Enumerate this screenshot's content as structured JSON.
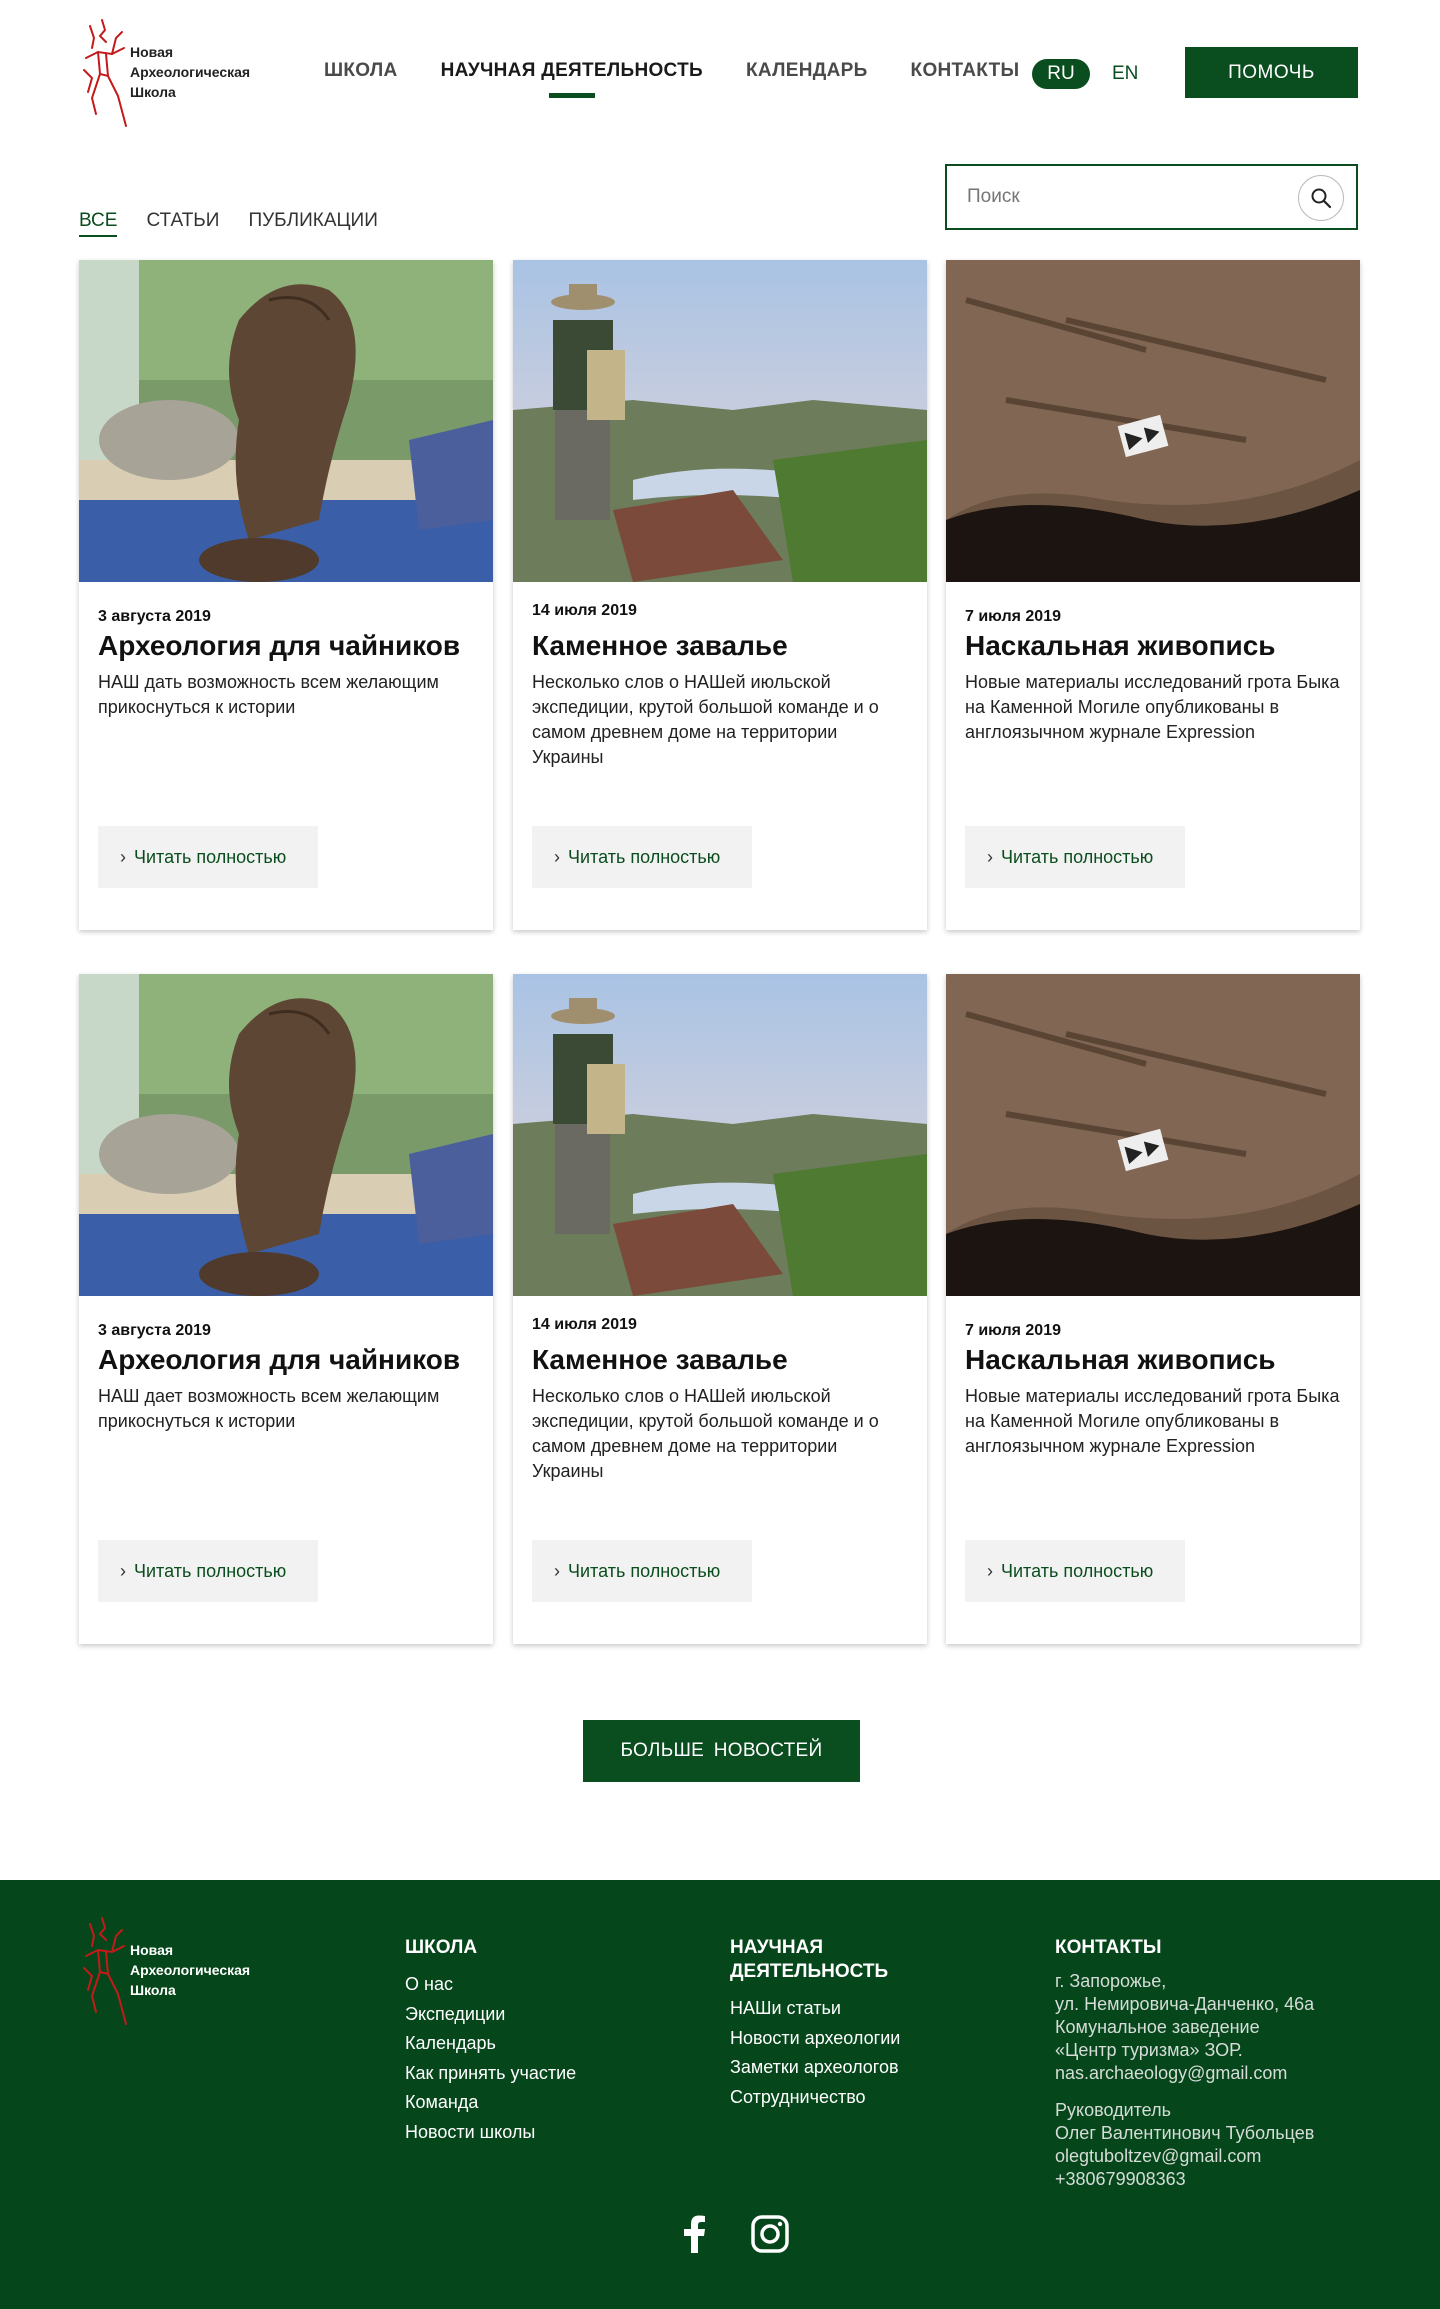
{
  "header": {
    "logo_lines": [
      "Новая",
      "Археологическая",
      "Школа"
    ],
    "nav": [
      {
        "label": "ШКОЛА",
        "active": false
      },
      {
        "label": "НАУЧНАЯ ДЕЯТЕЛЬНОСТЬ",
        "active": true
      },
      {
        "label": "КАЛЕНДАРЬ",
        "active": false
      },
      {
        "label": "КОНТАКТЫ",
        "active": false
      }
    ],
    "lang_ru": "RU",
    "lang_en": "EN",
    "help_label": "ПОМОЧЬ"
  },
  "filters": {
    "tabs": [
      {
        "label": "ВСЕ",
        "active": true
      },
      {
        "label": "СТАТЬИ",
        "active": false
      },
      {
        "label": "ПУБЛИКАЦИИ",
        "active": false
      }
    ]
  },
  "search": {
    "placeholder": "Поиск",
    "icon": "search-icon"
  },
  "cards": [
    {
      "image": "clay-pot-photo",
      "date": "3 августа 2019",
      "title": "Археология для чайников",
      "desc": "НАШ дать возможность всем желающим прикоснуться к истории",
      "read_label": "Читать полностью"
    },
    {
      "image": "hiker-canyon-photo",
      "date": "14  июля 2019",
      "title": "Каменное завалье",
      "desc": "Несколько слов о НАШей июльской экспедиции, крутой большой команде и о самом древнем доме на территории Украины",
      "read_label": "Читать полностью"
    },
    {
      "image": "rock-art-photo",
      "date": "7 июля 2019",
      "title": "Наскальная живопись",
      "desc": "Новые материалы исследований грота Быка на Каменной Могиле  опубликованы в англоязычном журнале Expression",
      "read_label": "Читать полностью"
    },
    {
      "image": "clay-pot-photo",
      "date": "3 августа 2019",
      "title": "Археология для чайников",
      "desc": "НАШ дает возможность всем желающим прикоснуться к истории",
      "read_label": "Читать полностью"
    },
    {
      "image": "hiker-canyon-photo",
      "date": "14  июля 2019",
      "title": "Каменное завалье",
      "desc": "Несколько слов о НАШей июльской экспедиции, крутой большой команде и о самом древнем доме на территории Украины",
      "read_label": "Читать полностью"
    },
    {
      "image": "rock-art-photo",
      "date": "7 июля 2019",
      "title": "Наскальная живопись",
      "desc": "Новые материалы исследований грота Быка на Каменной Могиле  опубликованы в англоязычном журнале Expression",
      "read_label": "Читать полностью"
    }
  ],
  "more_label": "БОЛЬШЕ  НОВОСТЕЙ",
  "footer": {
    "school": {
      "heading": "ШКОЛА",
      "links": [
        "О нас",
        "Экспедиции",
        "Календарь",
        "Как принять участие",
        "Команда",
        "Новости школы"
      ]
    },
    "science": {
      "heading_line1": "НАУЧНАЯ",
      "heading_line2": "ДЕЯТЕЛЬНОСТЬ",
      "links": [
        "НАШи статьи",
        "Новости археологии",
        "Заметки археологов",
        "Сотрудничество"
      ]
    },
    "contacts": {
      "heading": "КОНТАКТЫ",
      "address": [
        "г. Запорожье,",
        "ул. Немировича-Данченко, 46а",
        "Комунальное заведение",
        "«Центр туризма» ЗОР.",
        "nas.archaeology@gmail.com"
      ],
      "head": [
        "Руководитель",
        "Олег Валентинович Тубольцев",
        "olegtuboltzev@gmail.com",
        "+380679908363"
      ]
    },
    "social": [
      "facebook-icon",
      "instagram-icon"
    ]
  },
  "colors": {
    "brand_green": "#0a4d1e",
    "footer_green": "#05461b",
    "logo_red": "#c41a1a"
  }
}
